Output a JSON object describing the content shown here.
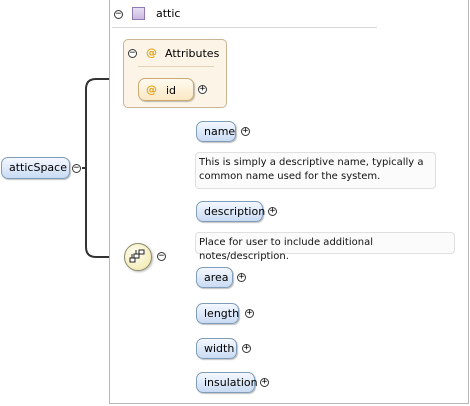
{
  "complex_type": {
    "name": "attic",
    "icon": "complex-type-icon"
  },
  "attributes": {
    "header": "Attributes",
    "items": [
      {
        "name": "id",
        "glyph": "@"
      }
    ],
    "glyph": "@"
  },
  "root": {
    "name": "atticSpace"
  },
  "compositor": {
    "type": "sequence",
    "icon": "sequence-icon"
  },
  "children": [
    {
      "name": "name",
      "doc": [
        "This is simply a descriptive name, typically a",
        "common name used for the system."
      ]
    },
    {
      "name": "description",
      "doc": [
        "Place for user to include additional notes/description."
      ]
    },
    {
      "name": "area"
    },
    {
      "name": "length"
    },
    {
      "name": "width"
    },
    {
      "name": "insulation"
    }
  ],
  "toggles": {
    "expand": "+",
    "collapse": "−"
  },
  "colors": {
    "element_fill": "#c9dbf3",
    "element_border": "#7f9db9",
    "attribute_fill": "#fbe8c4",
    "attribute_group_fill": "#fbf4e7",
    "connector": "#333333"
  }
}
